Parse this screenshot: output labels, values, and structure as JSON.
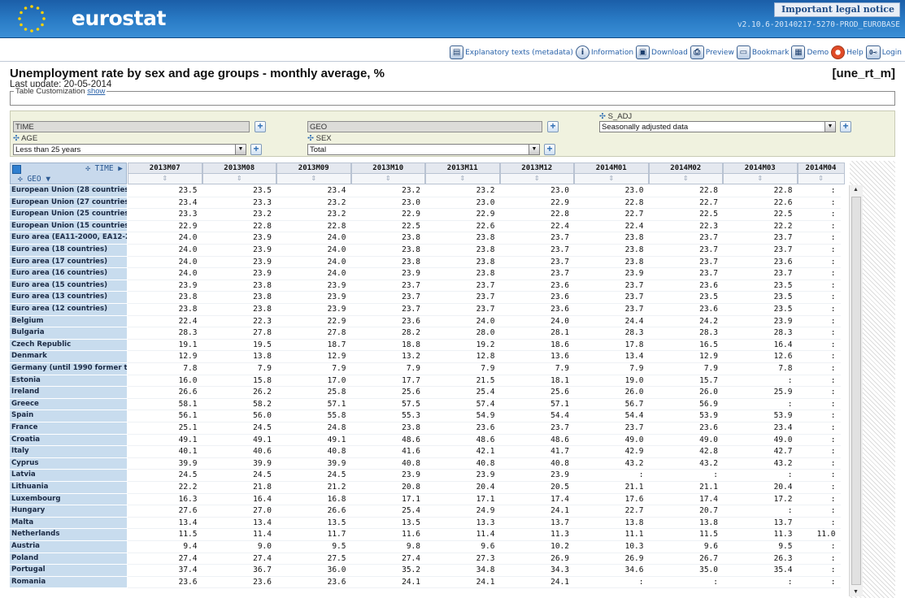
{
  "header": {
    "brand": "eurostat",
    "legal_notice": "Important legal notice",
    "version": "v2.10.6-20140217-5270-PROD_EUROBASE"
  },
  "toolbar": {
    "items": [
      {
        "label": "Explanatory texts (metadata)",
        "icon": "metadata-icon"
      },
      {
        "label": "Information",
        "icon": "info-icon"
      },
      {
        "label": "Download",
        "icon": "download-icon"
      },
      {
        "label": "Preview",
        "icon": "print-preview-icon"
      },
      {
        "label": "Bookmark",
        "icon": "bookmark-icon"
      },
      {
        "label": "Demo",
        "icon": "demo-icon"
      },
      {
        "label": "Help",
        "icon": "help-icon"
      },
      {
        "label": "Login",
        "icon": "login-icon"
      }
    ]
  },
  "page": {
    "title": "Unemployment rate by sex and age groups - monthly average, %",
    "code": "[une_rt_m]",
    "last_update": "Last update: 20-05-2014",
    "customization_label": "Table Customization",
    "customization_link": "show"
  },
  "filters": {
    "time_label": "TIME",
    "geo_label": "GEO",
    "s_adj_label": "S_ADJ",
    "s_adj_value": "Seasonally adjusted data",
    "age_label": "AGE",
    "age_value": "Less than 25 years",
    "sex_label": "SEX",
    "sex_value": "Total"
  },
  "table": {
    "time_axis_label": "TIME",
    "geo_axis_label": "GEO",
    "columns": [
      "2013M07",
      "2013M08",
      "2013M09",
      "2013M10",
      "2013M11",
      "2013M12",
      "2014M01",
      "2014M02",
      "2014M03",
      "2014M04"
    ],
    "rows": [
      {
        "geo": "European Union (28 countries)",
        "values": [
          "23.5",
          "23.5",
          "23.4",
          "23.2",
          "23.2",
          "23.0",
          "23.0",
          "22.8",
          "22.8",
          ":"
        ]
      },
      {
        "geo": "European Union (27 countries)",
        "values": [
          "23.4",
          "23.3",
          "23.2",
          "23.0",
          "23.0",
          "22.9",
          "22.8",
          "22.7",
          "22.6",
          ":"
        ]
      },
      {
        "geo": "European Union (25 countries)",
        "values": [
          "23.3",
          "23.2",
          "23.2",
          "22.9",
          "22.9",
          "22.8",
          "22.7",
          "22.5",
          "22.5",
          ":"
        ]
      },
      {
        "geo": "European Union (15 countries)",
        "values": [
          "22.9",
          "22.8",
          "22.8",
          "22.5",
          "22.6",
          "22.4",
          "22.4",
          "22.3",
          "22.2",
          ":"
        ]
      },
      {
        "geo": "Euro area (EA11-2000, EA12-2006",
        "values": [
          "24.0",
          "23.9",
          "24.0",
          "23.8",
          "23.8",
          "23.7",
          "23.8",
          "23.7",
          "23.7",
          ":"
        ]
      },
      {
        "geo": "Euro area (18 countries)",
        "values": [
          "24.0",
          "23.9",
          "24.0",
          "23.8",
          "23.8",
          "23.7",
          "23.8",
          "23.7",
          "23.7",
          ":"
        ]
      },
      {
        "geo": "Euro area (17 countries)",
        "values": [
          "24.0",
          "23.9",
          "24.0",
          "23.8",
          "23.8",
          "23.7",
          "23.8",
          "23.7",
          "23.6",
          ":"
        ]
      },
      {
        "geo": "Euro area (16 countries)",
        "values": [
          "24.0",
          "23.9",
          "24.0",
          "23.9",
          "23.8",
          "23.7",
          "23.9",
          "23.7",
          "23.7",
          ":"
        ]
      },
      {
        "geo": "Euro area (15 countries)",
        "values": [
          "23.9",
          "23.8",
          "23.9",
          "23.7",
          "23.7",
          "23.6",
          "23.7",
          "23.6",
          "23.5",
          ":"
        ]
      },
      {
        "geo": "Euro area (13 countries)",
        "values": [
          "23.8",
          "23.8",
          "23.9",
          "23.7",
          "23.7",
          "23.6",
          "23.7",
          "23.5",
          "23.5",
          ":"
        ]
      },
      {
        "geo": "Euro area (12 countries)",
        "values": [
          "23.8",
          "23.8",
          "23.9",
          "23.7",
          "23.7",
          "23.6",
          "23.7",
          "23.6",
          "23.5",
          ":"
        ]
      },
      {
        "geo": "Belgium",
        "values": [
          "22.4",
          "22.3",
          "22.9",
          "23.6",
          "24.0",
          "24.0",
          "24.4",
          "24.2",
          "23.9",
          ":"
        ]
      },
      {
        "geo": "Bulgaria",
        "values": [
          "28.3",
          "27.8",
          "27.8",
          "28.2",
          "28.0",
          "28.1",
          "28.3",
          "28.3",
          "28.3",
          ":"
        ]
      },
      {
        "geo": "Czech Republic",
        "values": [
          "19.1",
          "19.5",
          "18.7",
          "18.8",
          "19.2",
          "18.6",
          "17.8",
          "16.5",
          "16.4",
          ":"
        ]
      },
      {
        "geo": "Denmark",
        "values": [
          "12.9",
          "13.8",
          "12.9",
          "13.2",
          "12.8",
          "13.6",
          "13.4",
          "12.9",
          "12.6",
          ":"
        ]
      },
      {
        "geo": "Germany (until 1990 former terri",
        "values": [
          "7.8",
          "7.9",
          "7.9",
          "7.9",
          "7.9",
          "7.9",
          "7.9",
          "7.9",
          "7.8",
          ":"
        ]
      },
      {
        "geo": "Estonia",
        "values": [
          "16.0",
          "15.8",
          "17.0",
          "17.7",
          "21.5",
          "18.1",
          "19.0",
          "15.7",
          ":",
          ":"
        ]
      },
      {
        "geo": "Ireland",
        "values": [
          "26.6",
          "26.2",
          "25.8",
          "25.6",
          "25.4",
          "25.6",
          "26.0",
          "26.0",
          "25.9",
          ":"
        ]
      },
      {
        "geo": "Greece",
        "values": [
          "58.1",
          "58.2",
          "57.1",
          "57.5",
          "57.4",
          "57.1",
          "56.7",
          "56.9",
          ":",
          ":"
        ]
      },
      {
        "geo": "Spain",
        "values": [
          "56.1",
          "56.0",
          "55.8",
          "55.3",
          "54.9",
          "54.4",
          "54.4",
          "53.9",
          "53.9",
          ":"
        ]
      },
      {
        "geo": "France",
        "values": [
          "25.1",
          "24.5",
          "24.8",
          "23.8",
          "23.6",
          "23.7",
          "23.7",
          "23.6",
          "23.4",
          ":"
        ]
      },
      {
        "geo": "Croatia",
        "values": [
          "49.1",
          "49.1",
          "49.1",
          "48.6",
          "48.6",
          "48.6",
          "49.0",
          "49.0",
          "49.0",
          ":"
        ]
      },
      {
        "geo": "Italy",
        "values": [
          "40.1",
          "40.6",
          "40.8",
          "41.6",
          "42.1",
          "41.7",
          "42.9",
          "42.8",
          "42.7",
          ":"
        ]
      },
      {
        "geo": "Cyprus",
        "values": [
          "39.9",
          "39.9",
          "39.9",
          "40.8",
          "40.8",
          "40.8",
          "43.2",
          "43.2",
          "43.2",
          ":"
        ]
      },
      {
        "geo": "Latvia",
        "values": [
          "24.5",
          "24.5",
          "24.5",
          "23.9",
          "23.9",
          "23.9",
          ":",
          ":",
          ":",
          ":"
        ]
      },
      {
        "geo": "Lithuania",
        "values": [
          "22.2",
          "21.8",
          "21.2",
          "20.8",
          "20.4",
          "20.5",
          "21.1",
          "21.1",
          "20.4",
          ":"
        ]
      },
      {
        "geo": "Luxembourg",
        "values": [
          "16.3",
          "16.4",
          "16.8",
          "17.1",
          "17.1",
          "17.4",
          "17.6",
          "17.4",
          "17.2",
          ":"
        ]
      },
      {
        "geo": "Hungary",
        "values": [
          "27.6",
          "27.0",
          "26.6",
          "25.4",
          "24.9",
          "24.1",
          "22.7",
          "20.7",
          ":",
          ":"
        ]
      },
      {
        "geo": "Malta",
        "values": [
          "13.4",
          "13.4",
          "13.5",
          "13.5",
          "13.3",
          "13.7",
          "13.8",
          "13.8",
          "13.7",
          ":"
        ]
      },
      {
        "geo": "Netherlands",
        "values": [
          "11.5",
          "11.4",
          "11.7",
          "11.6",
          "11.4",
          "11.3",
          "11.1",
          "11.5",
          "11.3",
          "11.0"
        ]
      },
      {
        "geo": "Austria",
        "values": [
          "9.4",
          "9.0",
          "9.5",
          "9.8",
          "9.6",
          "10.2",
          "10.3",
          "9.6",
          "9.5",
          ":"
        ]
      },
      {
        "geo": "Poland",
        "values": [
          "27.4",
          "27.4",
          "27.5",
          "27.4",
          "27.3",
          "26.9",
          "26.9",
          "26.7",
          "26.3",
          ":"
        ]
      },
      {
        "geo": "Portugal",
        "values": [
          "37.4",
          "36.7",
          "36.0",
          "35.2",
          "34.8",
          "34.3",
          "34.6",
          "35.0",
          "35.4",
          ":"
        ]
      },
      {
        "geo": "Romania",
        "values": [
          "23.6",
          "23.6",
          "23.6",
          "24.1",
          "24.1",
          "24.1",
          ":",
          ":",
          ":",
          ":"
        ]
      }
    ]
  }
}
